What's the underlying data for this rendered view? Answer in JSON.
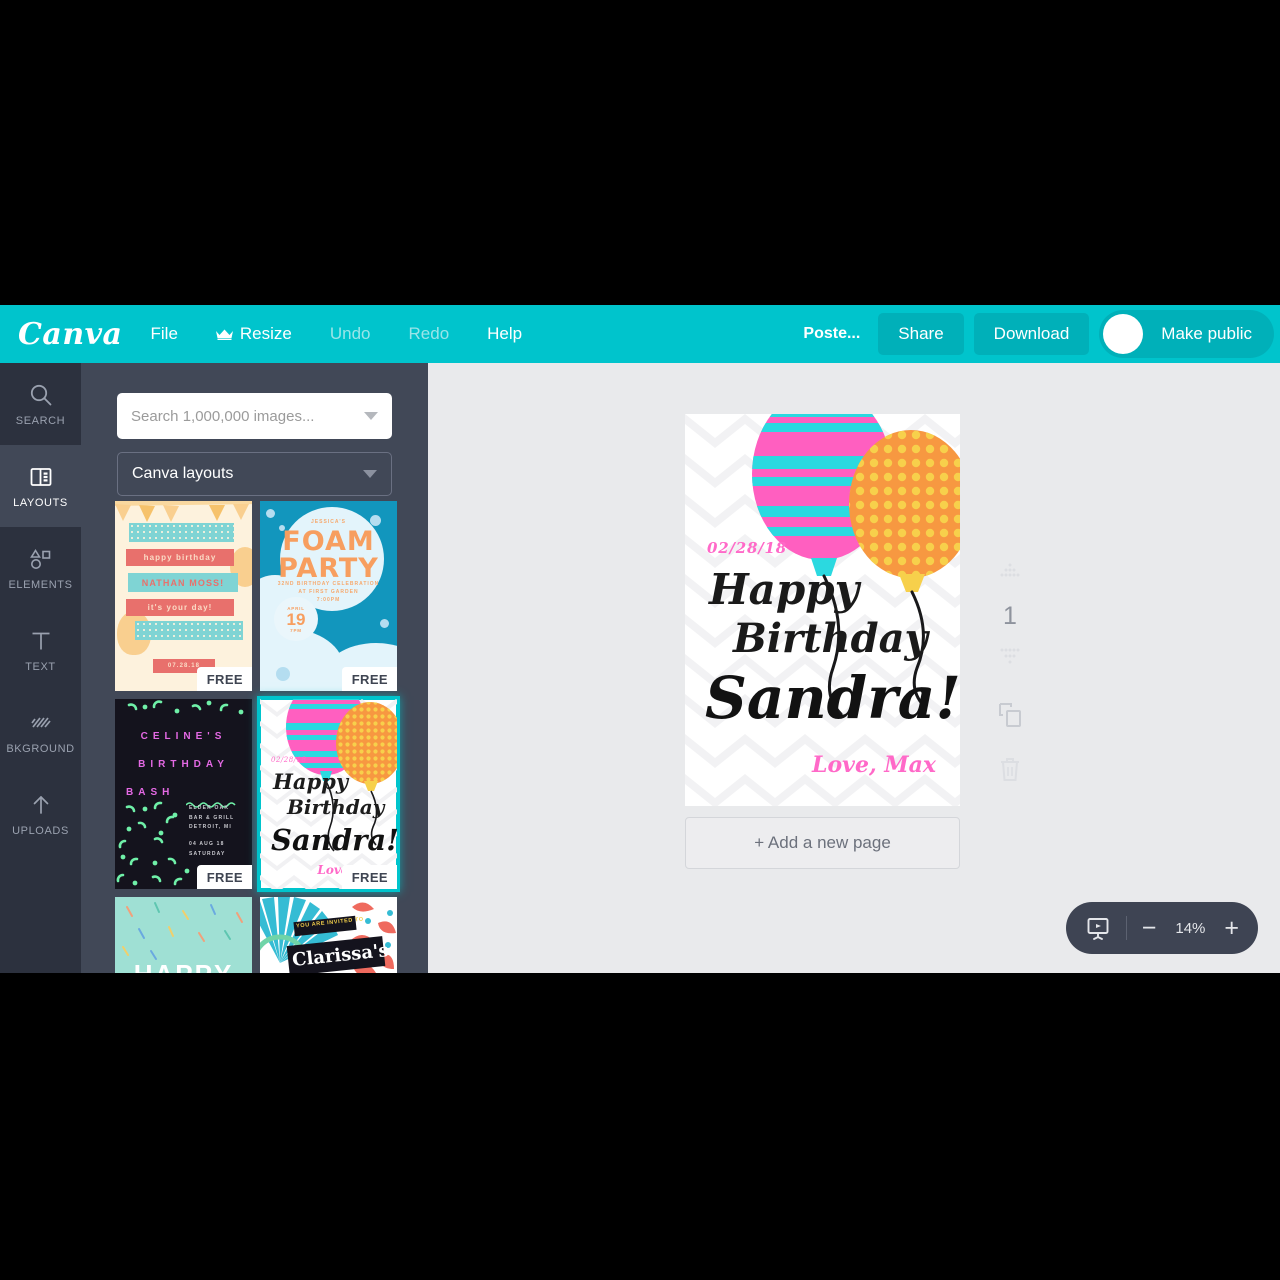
{
  "app": {
    "brand": "Canva",
    "accent_color": "#00c4cc",
    "panel_color": "#414857",
    "rail_color": "#2c313e",
    "canvas_color": "#e9eaec"
  },
  "topbar": {
    "menu": [
      {
        "label": "File",
        "dim": false,
        "icon": null
      },
      {
        "label": "Resize",
        "dim": false,
        "icon": "crown-icon"
      },
      {
        "label": "Undo",
        "dim": true,
        "icon": null
      },
      {
        "label": "Redo",
        "dim": true,
        "icon": null
      },
      {
        "label": "Help",
        "dim": false,
        "icon": null
      }
    ],
    "doc_title": "Poste...",
    "share_label": "Share",
    "download_label": "Download",
    "make_public_label": "Make public",
    "toggle_state": "on"
  },
  "rail": {
    "items": [
      {
        "label": "SEARCH",
        "icon": "search-icon",
        "active": false
      },
      {
        "label": "LAYOUTS",
        "icon": "layouts-icon",
        "active": true
      },
      {
        "label": "ELEMENTS",
        "icon": "elements-icon",
        "active": false
      },
      {
        "label": "TEXT",
        "icon": "text-icon",
        "active": false
      },
      {
        "label": "BKGROUND",
        "icon": "background-icon",
        "active": false
      },
      {
        "label": "UPLOADS",
        "icon": "upload-icon",
        "active": false
      }
    ]
  },
  "panel": {
    "search": {
      "placeholder": "Search 1,000,000 images...",
      "value": "",
      "caret_icon": "chevron-down-icon"
    },
    "category_select": {
      "value": "Canva layouts",
      "caret_icon": "chevron-down-icon"
    },
    "free_badge": "FREE",
    "thumbs": [
      {
        "id": "nathan-moss",
        "selected": false,
        "badge": "FREE",
        "lines": [
          "happy birthday",
          "NATHAN MOSS!",
          "it's your day!",
          "07.28.18"
        ]
      },
      {
        "id": "foam-party",
        "selected": false,
        "badge": "FREE",
        "lines": [
          "JESSICA'S",
          "FOAM",
          "PARTY",
          "32ND BIRTHDAY CELEBRATION",
          "AT FIRST GARDEN",
          "7:00PM",
          "APRIL",
          "19",
          "7PM"
        ]
      },
      {
        "id": "celines-birthday-bash",
        "selected": false,
        "badge": "FREE",
        "lines": [
          "CELINE'S",
          "BIRTHDAY",
          "BASH",
          "ELDER OAK",
          "BAR & GRILL",
          "DETROIT, MI",
          "04 AUG 18",
          "SATURDAY"
        ]
      },
      {
        "id": "sandra-birthday",
        "selected": true,
        "badge": "FREE",
        "lines": [
          "02/28/18",
          "Happy",
          "Birthday",
          "Sandra!",
          "Love, Max"
        ]
      },
      {
        "id": "happy-confetti",
        "selected": false,
        "badge": "",
        "lines": [
          "HAPPY"
        ]
      },
      {
        "id": "clarissas-invite",
        "selected": false,
        "badge": "",
        "lines": [
          "YOU ARE INVITED TO",
          "Clarissa's"
        ]
      }
    ]
  },
  "poster": {
    "date": "02/28/18",
    "line1": "Happy",
    "line2": "Birthday",
    "line3": "Sandra!",
    "signature": "Love, Max",
    "colors": {
      "pink": "#ff5fc0",
      "cyan": "#2bd9e0",
      "orange": "#f79841",
      "yellow_dot": "#f7d04b",
      "signature_pink": "#ff69c8"
    }
  },
  "canvas": {
    "add_page_label": "+ Add a new page",
    "page_number": "1",
    "tools": [
      {
        "name": "move-up-icon"
      },
      {
        "name": "move-down-icon"
      },
      {
        "name": "duplicate-page-icon"
      },
      {
        "name": "delete-page-icon"
      }
    ]
  },
  "zoombar": {
    "present_icon": "present-icon",
    "minus_label": "−",
    "zoom_level": "14%",
    "plus_label": "+"
  }
}
